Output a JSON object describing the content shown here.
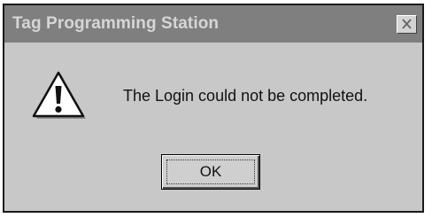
{
  "window": {
    "title": "Tag Programming Station",
    "close_icon": "close-icon"
  },
  "dialog": {
    "icon": "warning-icon",
    "message": "The Login could not be completed.",
    "ok_label": "OK"
  },
  "colors": {
    "titlebar_inactive": "#7f7f7f",
    "title_text": "#d6d6d6",
    "dialog_face": "#c8c8c8"
  }
}
